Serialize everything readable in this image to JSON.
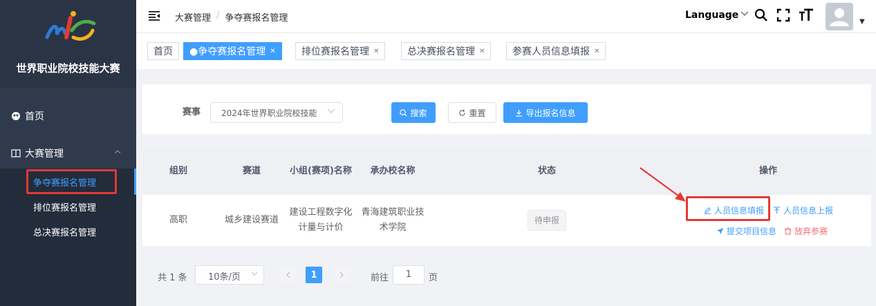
{
  "sidebar": {
    "title": "世界职业院校技能大赛",
    "home": "首页",
    "group": "大赛管理",
    "items": [
      {
        "label": "争夺赛报名管理"
      },
      {
        "label": "排位赛报名管理"
      },
      {
        "label": "总决赛报名管理"
      }
    ]
  },
  "header": {
    "breadcrumb": [
      "大赛管理",
      "争夺赛报名管理"
    ],
    "language": "Language"
  },
  "tags": [
    {
      "label": "首页"
    },
    {
      "label": "●争夺赛报名管理"
    },
    {
      "label": "排位赛报名管理"
    },
    {
      "label": "总决赛报名管理"
    },
    {
      "label": "参赛人员信息填报"
    }
  ],
  "filter": {
    "label": "赛事",
    "select_value": "2024年世界职业院校技能",
    "search": "搜索",
    "reset": "重置",
    "export": "导出报名信息"
  },
  "table": {
    "columns": [
      "组别",
      "赛道",
      "小组(赛项)名称",
      "承办校名称",
      "状态",
      "操作"
    ],
    "rows": [
      {
        "group": "高职",
        "track": "城乡建设赛道",
        "name": "建设工程数字化计量与计价",
        "school": "青海建筑职业技术学院",
        "status": "待申报"
      }
    ],
    "actions": {
      "fill": "人员信息填报",
      "report": "人员信息上报",
      "submit": "提交项目信息",
      "abandon": "放弃参赛"
    }
  },
  "pagination": {
    "total": "共 1 条",
    "page_size": "10条/页",
    "current": "1",
    "goto": "前往",
    "goto_value": "1",
    "page_suffix": "页"
  },
  "colors": {
    "primary": "#409eff",
    "danger": "#f56c6c",
    "sidebar": "#2f3a4c",
    "highlight": "#e53935"
  }
}
